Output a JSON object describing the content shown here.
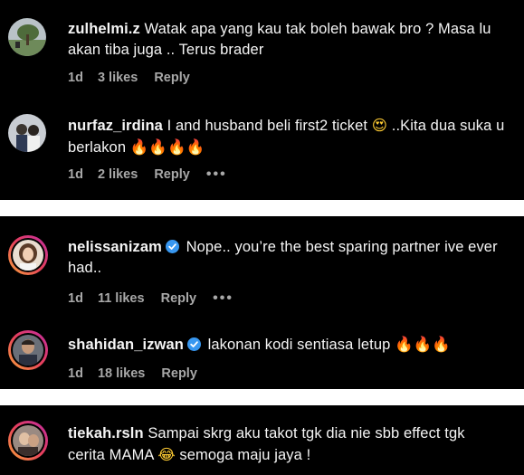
{
  "comments": [
    {
      "username": "zulhelmi.z",
      "verified": false,
      "text": "Watak apa yang kau tak boleh bawak bro ? Masa lu akan tiba juga .. Terus brader",
      "time": "1d",
      "likes": "3 likes",
      "reply": "Reply",
      "more": ""
    },
    {
      "username": "nurfaz_irdina",
      "verified": false,
      "text": "I and husband beli first2 ticket",
      "emoji_1": "😍",
      "text_2": "..Kita dua suka u berlakon",
      "emoji_2": "🔥🔥🔥🔥",
      "time": "1d",
      "likes": "2 likes",
      "reply": "Reply",
      "more": "•••"
    },
    {
      "username": "nelissanizam",
      "verified": true,
      "text": "Nope.. you’re the best sparing partner ive ever had..",
      "time": "1d",
      "likes": "11 likes",
      "reply": "Reply",
      "more": "•••"
    },
    {
      "username": "shahidan_izwan",
      "verified": true,
      "text": "lakonan kodi sentiasa letup",
      "emoji_1": "🔥🔥🔥",
      "time": "1d",
      "likes": "18 likes",
      "reply": "Reply",
      "more": ""
    },
    {
      "username": "tiekah.rsln",
      "verified": false,
      "text": "Sampai skrg aku takot tgk dia nie sbb effect tgk cerita MAMA",
      "emoji_1": "😂",
      "text_2": "semoga maju jaya !"
    }
  ],
  "colors": {
    "background": "#000000",
    "text": "#f5f5f5",
    "meta": "#a8a8a8",
    "verified": "#3897f0",
    "separator": "#ffffff"
  },
  "icons": {
    "verified": "verified-badge-icon",
    "more": "more-options-icon"
  }
}
